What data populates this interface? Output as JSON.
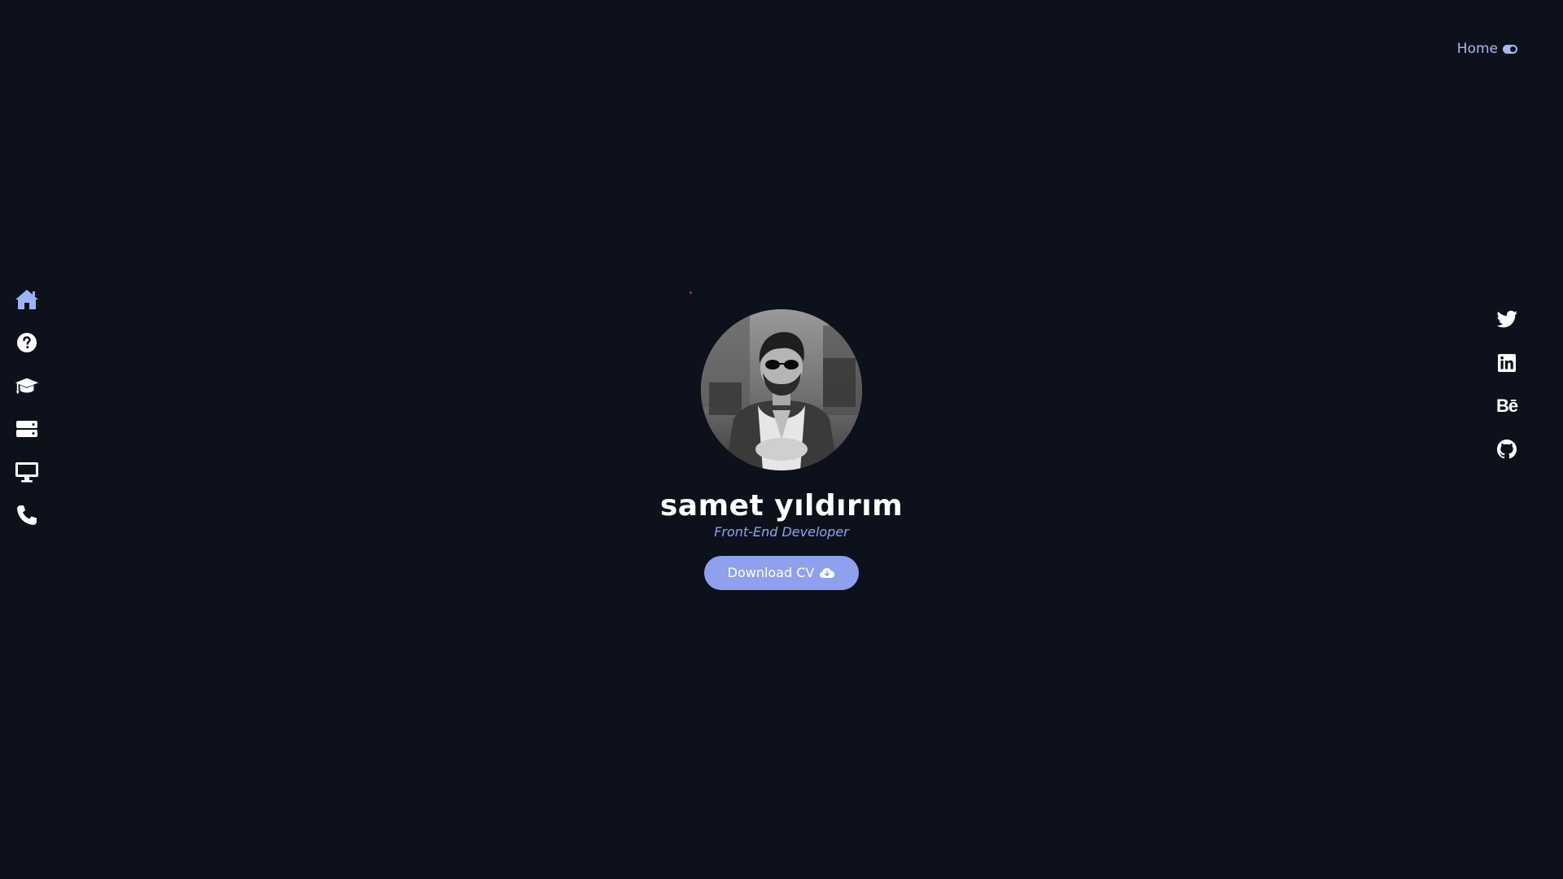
{
  "top_nav": {
    "label": "Home"
  },
  "left_nav": {
    "items": [
      {
        "icon": "home-icon",
        "active": true
      },
      {
        "icon": "question-icon"
      },
      {
        "icon": "graduation-cap-icon"
      },
      {
        "icon": "server-icon"
      },
      {
        "icon": "desktop-icon"
      },
      {
        "icon": "phone-icon"
      }
    ]
  },
  "social": {
    "items": [
      {
        "icon": "twitter-icon"
      },
      {
        "icon": "linkedin-icon"
      },
      {
        "icon": "behance-icon",
        "text": "Bē"
      },
      {
        "icon": "github-icon"
      }
    ]
  },
  "profile": {
    "name": "samet yıldırım",
    "role": "Front-End Developer",
    "cv_button_label": "Download CV",
    "cv_button_icon": "cloud-download-icon"
  },
  "colors": {
    "background": "#0d111b",
    "accent": "#8ea0ee",
    "accent_text": "#8ea6ee",
    "active_nav": "#9db3f5"
  }
}
